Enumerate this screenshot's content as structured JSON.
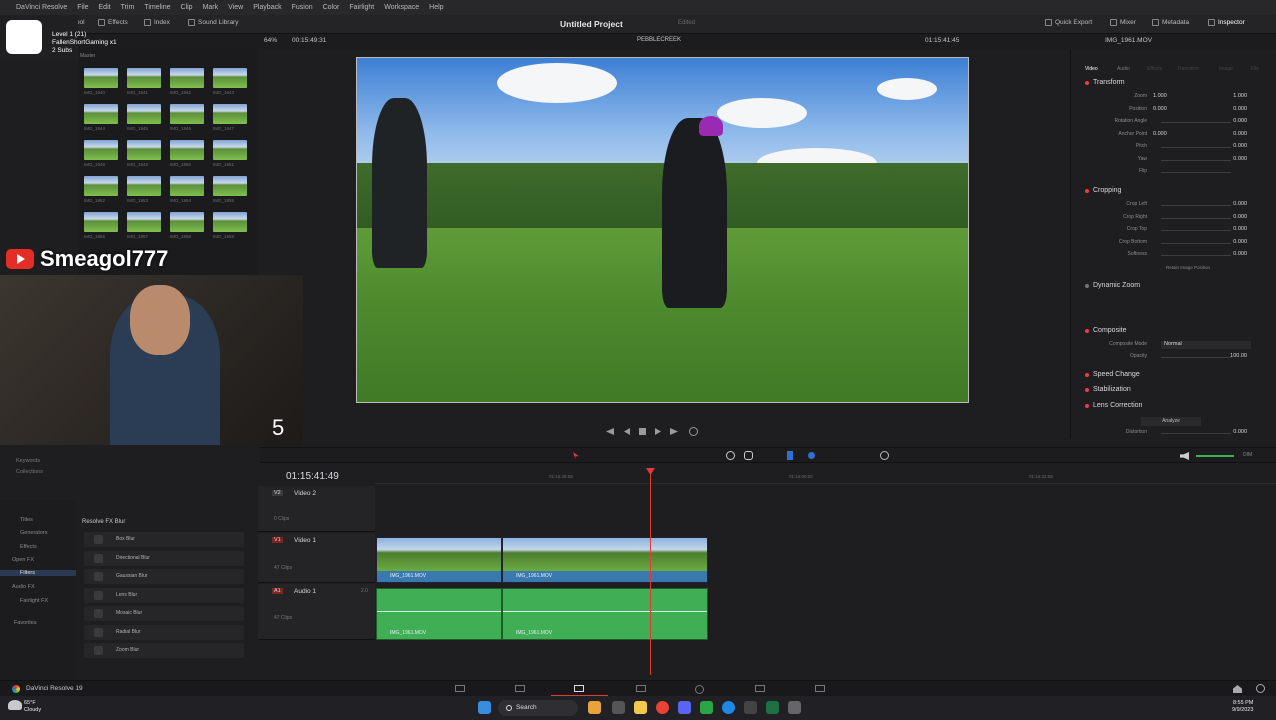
{
  "menu": {
    "app": "DaVinci Resolve",
    "items": [
      "File",
      "Edit",
      "Trim",
      "Timeline",
      "Clip",
      "Mark",
      "View",
      "Playback",
      "Fusion",
      "Color",
      "Fairlight",
      "Workspace",
      "Help"
    ]
  },
  "toolbar": {
    "media_pool": "Media Pool",
    "effects": "Effects",
    "index": "Index",
    "sound_library": "Sound Library",
    "quick_export": "Quick Export",
    "mixer": "Mixer",
    "metadata": "Metadata",
    "inspector": "Inspector"
  },
  "project": {
    "title": "Untitled Project",
    "status": "Edited"
  },
  "overlay": {
    "level": "Level 1 (21)",
    "channel": "FallenShortGaming x1",
    "subs": "2 Subs",
    "streamer": "Smeagol777",
    "counter": "5"
  },
  "viewer": {
    "zoom": "64%",
    "timecode_left": "00:15:49:31",
    "timeline_name": "PEBBLECREEK",
    "timecode_right": "01:15:41:45",
    "clip_name": "IMG_1961.MOV"
  },
  "mediapool": {
    "folder": "Master",
    "thumbs": [
      "IMG_1940",
      "IMG_1941",
      "IMG_1942",
      "IMG_1943",
      "IMG_1944",
      "IMG_1945",
      "IMG_1946",
      "IMG_1947",
      "IMG_1948",
      "IMG_1949",
      "IMG_1950",
      "IMG_1951",
      "IMG_1952",
      "IMG_1953",
      "IMG_1954",
      "IMG_1955",
      "IMG_1956",
      "IMG_1957",
      "IMG_1958",
      "IMG_1959"
    ]
  },
  "inspector": {
    "tabs": [
      "Video",
      "Audio",
      "Effects",
      "Transition",
      "Image",
      "File"
    ],
    "transform": {
      "title": "Transform",
      "rows": [
        {
          "label": "Zoom",
          "x": "1.000",
          "y": "1.000"
        },
        {
          "label": "Position",
          "x": "0.000",
          "y": "0.000"
        },
        {
          "label": "Rotation Angle",
          "v": "0.000"
        },
        {
          "label": "Anchor Point",
          "x": "0.000",
          "y": "0.000"
        },
        {
          "label": "Pitch",
          "v": "0.000"
        },
        {
          "label": "Yaw",
          "v": "0.000"
        },
        {
          "label": "Flip",
          "v": ""
        }
      ]
    },
    "cropping": {
      "title": "Cropping",
      "rows": [
        {
          "label": "Crop Left",
          "v": "0.000"
        },
        {
          "label": "Crop Right",
          "v": "0.000"
        },
        {
          "label": "Crop Top",
          "v": "0.000"
        },
        {
          "label": "Crop Bottom",
          "v": "0.000"
        },
        {
          "label": "Softness",
          "v": "0.000"
        }
      ],
      "retain": "Retain Image Position"
    },
    "dynamic_zoom": "Dynamic Zoom",
    "composite": {
      "title": "Composite",
      "mode_label": "Composite Mode",
      "mode": "Normal",
      "opacity_label": "Opacity",
      "opacity": "100.00"
    },
    "speed_change": "Speed Change",
    "stabilization": "Stabilization",
    "lens_correction": {
      "title": "Lens Correction",
      "analyze": "Analyze",
      "distortion_label": "Distortion",
      "distortion": "0.000"
    }
  },
  "timeline": {
    "timecode": "01:15:41:49",
    "ruler": [
      "01:15:28:08",
      "01:16:00:00",
      "01:16:32:08"
    ],
    "tracks": [
      {
        "id": "V2",
        "name": "Video 2",
        "clips": "0 Clips"
      },
      {
        "id": "V1",
        "name": "Video 1",
        "clips": "47 Clips"
      },
      {
        "id": "A1",
        "name": "Audio 1",
        "clips": "47 Clips"
      }
    ],
    "clip_labels": [
      "IMG_1961.MOV",
      "IMG_1961.MOV"
    ],
    "audio_channels": "2.0",
    "volume_label": "DIM"
  },
  "effects": {
    "categories": [
      "Titles",
      "Generators",
      "Effects",
      "Open FX",
      "Filters",
      "Audio FX",
      "Fairlight FX",
      "Favorites"
    ],
    "selected": "Filters",
    "group": "Resolve FX Blur",
    "items": [
      "Box Blur",
      "Directional Blur",
      "Gaussian Blur",
      "Lens Blur",
      "Mosaic Blur",
      "Radial Blur",
      "Zoom Blur"
    ],
    "bins": [
      "Keywords",
      "Collections"
    ]
  },
  "pagebar": {
    "app": "DaVinci Resolve 19"
  },
  "taskbar": {
    "weather_temp": "65°F",
    "weather_text": "Cloudy",
    "search": "Search",
    "time": "8:55 PM",
    "date": "9/9/2023"
  },
  "colors": {
    "accent": "#e23a35",
    "clip_video": "#3a79b0",
    "clip_audio": "#3fae54",
    "bg": "#1e1e21"
  }
}
